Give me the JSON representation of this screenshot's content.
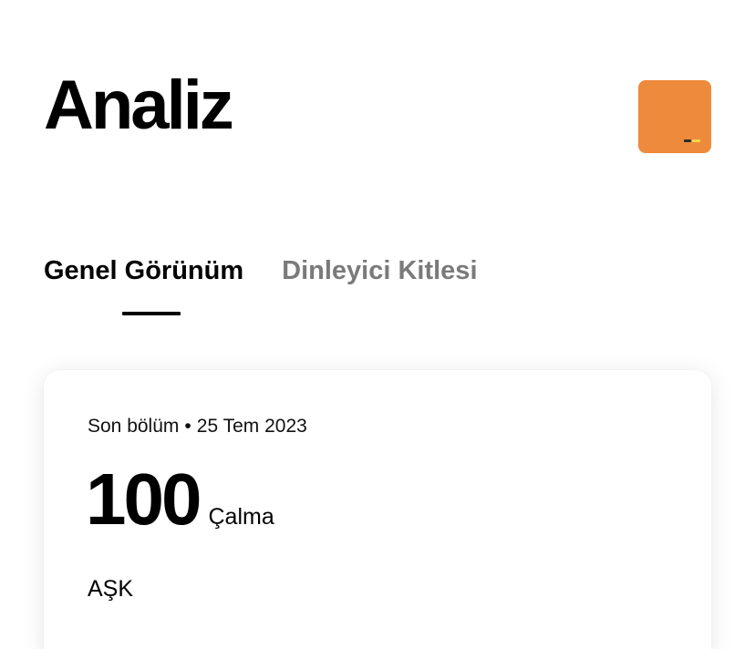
{
  "header": {
    "title": "Analiz",
    "cover_icon": "podcast-cover-art"
  },
  "tabs": [
    {
      "label": "Genel Görünüm",
      "active": true
    },
    {
      "label": "Dinleyici Kitlesi",
      "active": false
    }
  ],
  "card": {
    "meta_label": "Son bölüm",
    "separator": "•",
    "date": "25 Tem 2023",
    "plays_value": "100",
    "plays_unit": "Çalma",
    "episode_title": "AŞK"
  },
  "colors": {
    "accent_cover": "#ee8a3c",
    "active_tab": "#000000",
    "inactive_tab": "#7a7a7a"
  }
}
